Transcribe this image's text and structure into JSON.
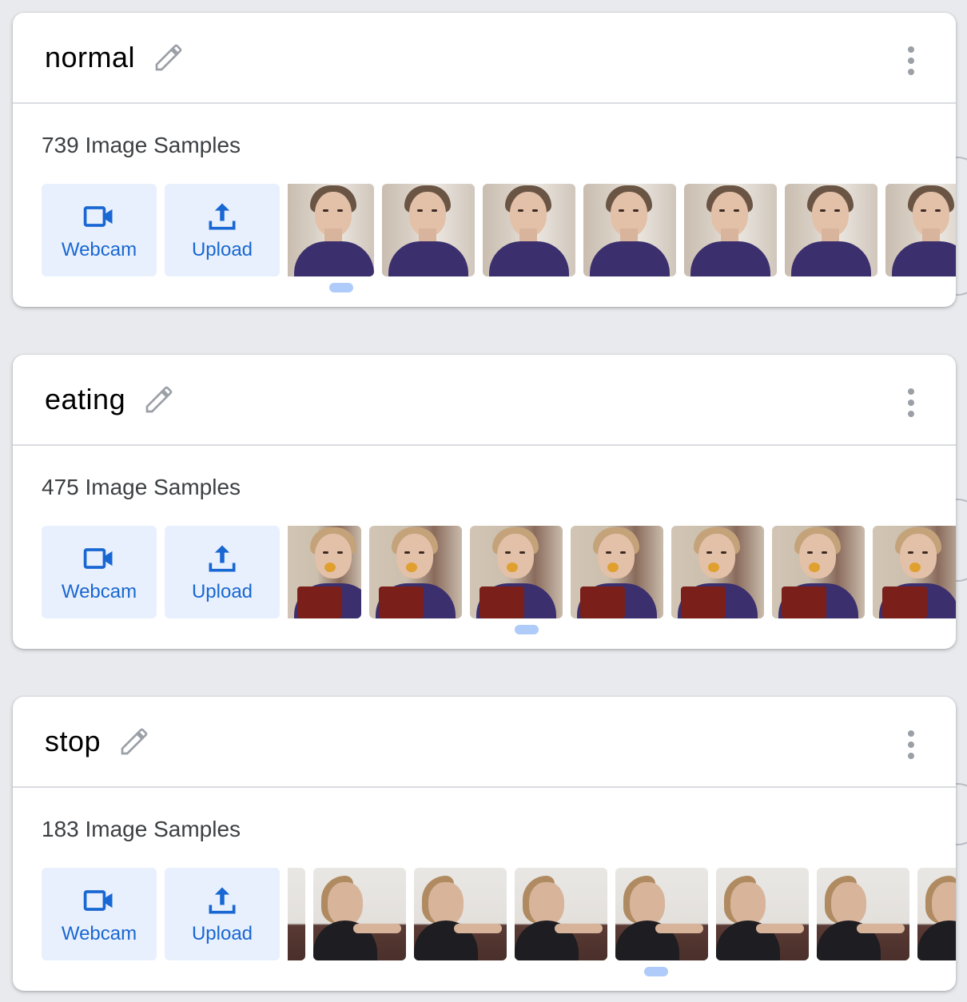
{
  "classes": [
    {
      "name": "normal",
      "count_label": "739 Image Samples",
      "webcam_label": "Webcam",
      "upload_label": "Upload"
    },
    {
      "name": "eating",
      "count_label": "475 Image Samples",
      "webcam_label": "Webcam",
      "upload_label": "Upload"
    },
    {
      "name": "stop",
      "count_label": "183 Image Samples",
      "webcam_label": "Webcam",
      "upload_label": "Upload"
    }
  ],
  "icons": {
    "edit": "pencil-icon",
    "menu": "more-vert-icon",
    "webcam": "videocam-icon",
    "upload": "upload-icon"
  },
  "colors": {
    "accent": "#1967d2",
    "button_bg": "#e8f0fe",
    "page_bg": "#e8eaed",
    "scroll_indicator": "#aecbfa"
  }
}
